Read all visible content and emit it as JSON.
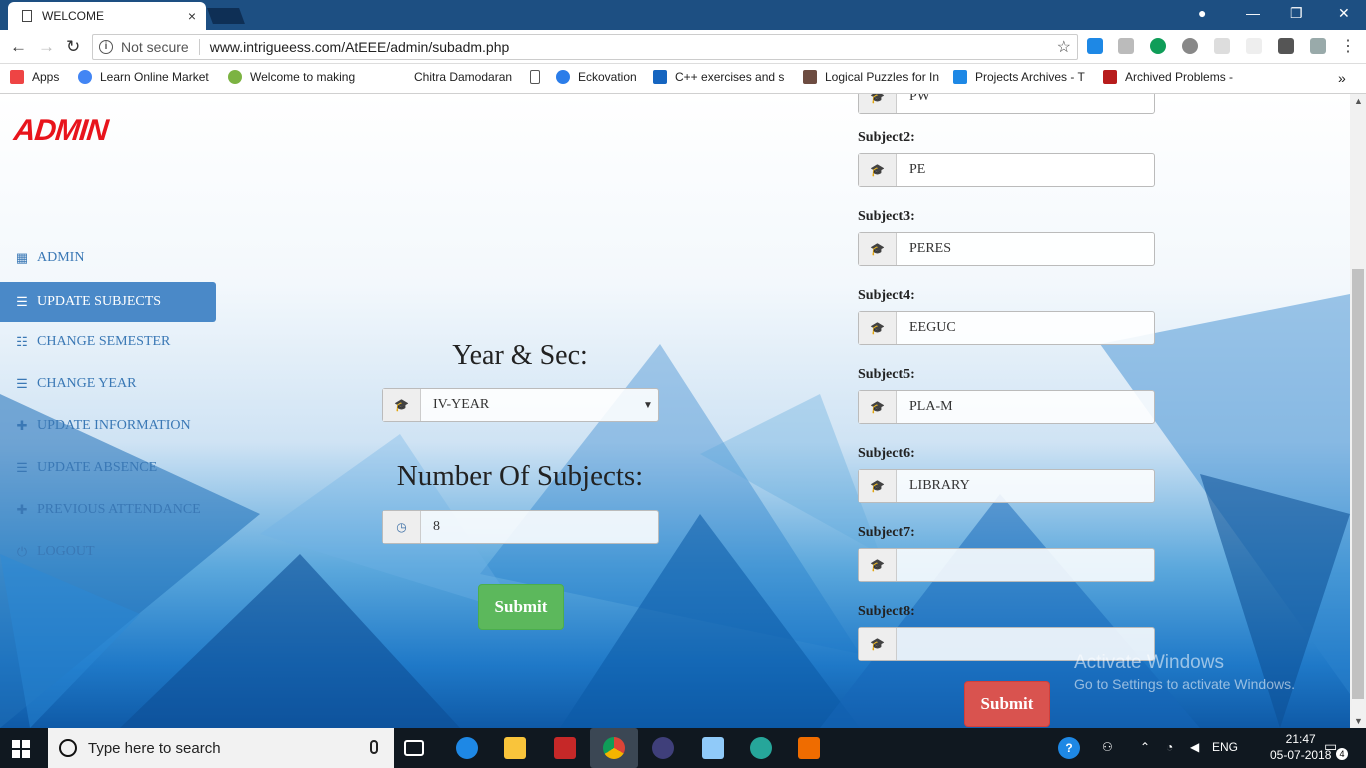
{
  "browser": {
    "tab_title": "WELCOME",
    "tab_close": "×",
    "not_secure": "Not secure",
    "url": "www.intrigueess.com/AtEEE/admin/subadm.php",
    "bookmarks": [
      {
        "label": "Apps",
        "color": "#e44"
      },
      {
        "label": "Learn Online Market",
        "color": "#4285f4"
      },
      {
        "label": "Welcome to making",
        "color": "#7cb342"
      },
      {
        "label": "Chitra Damodaran",
        "color": "#ffffff"
      },
      {
        "label": "",
        "color": "#ffffff"
      },
      {
        "label": "Eckovation",
        "color": "#2b7de9"
      },
      {
        "label": "C++ exercises and s",
        "color": "#1565c0"
      },
      {
        "label": "Logical Puzzles for In",
        "color": "#6d4c41"
      },
      {
        "label": "Projects Archives - T",
        "color": "#1e88e5"
      },
      {
        "label": "Archived Problems -",
        "color": "#b71c1c"
      }
    ],
    "more": "»"
  },
  "sidebar": {
    "logo": "ADMIN",
    "items": [
      {
        "label": "ADMIN",
        "icon": "calendar-icon",
        "glyph": "▦",
        "active": false
      },
      {
        "label": "UPDATE SUBJECTS",
        "icon": "list-icon",
        "glyph": "☰",
        "active": true
      },
      {
        "label": "CHANGE SEMESTER",
        "icon": "list-ul-icon",
        "glyph": "☷",
        "active": false
      },
      {
        "label": "CHANGE YEAR",
        "icon": "list-icon",
        "glyph": "☰",
        "active": false
      },
      {
        "label": "UPDATE INFORMATION",
        "icon": "plus-icon",
        "glyph": "✚",
        "active": false
      },
      {
        "label": "UPDATE ABSENCE",
        "icon": "list-icon",
        "glyph": "☰",
        "active": false
      },
      {
        "label": "PREVIOUS ATTENDANCE",
        "icon": "plus-icon",
        "glyph": "✚",
        "active": false
      },
      {
        "label": "LOGOUT",
        "icon": "power-icon",
        "glyph": "⏻",
        "active": false
      }
    ]
  },
  "form_left": {
    "year_heading": "Year & Sec:",
    "year_value": "IV-YEAR",
    "count_heading": "Number Of Subjects:",
    "count_value": "8",
    "submit": "Submit"
  },
  "form_right": {
    "top_partial_value": "PW",
    "subjects": [
      {
        "label": "Subject2:",
        "value": "PE"
      },
      {
        "label": "Subject3:",
        "value": "PERES"
      },
      {
        "label": "Subject4:",
        "value": "EEGUC"
      },
      {
        "label": "Subject5:",
        "value": "PLA-M"
      },
      {
        "label": "Subject6:",
        "value": "LIBRARY"
      },
      {
        "label": "Subject7:",
        "value": ""
      },
      {
        "label": "Subject8:",
        "value": ""
      }
    ],
    "submit": "Submit"
  },
  "watermark": {
    "line1": "Activate Windows",
    "line2": "Go to Settings to activate Windows."
  },
  "taskbar": {
    "search_placeholder": "Type here to search",
    "language": "ENG",
    "time": "21:47",
    "date": "05-07-2018",
    "notifications": "4"
  },
  "colors": {
    "accent": "#4a89c8",
    "submit_green": "#5cb85c",
    "submit_red": "#d9534f",
    "logo_red": "#e8141c"
  }
}
